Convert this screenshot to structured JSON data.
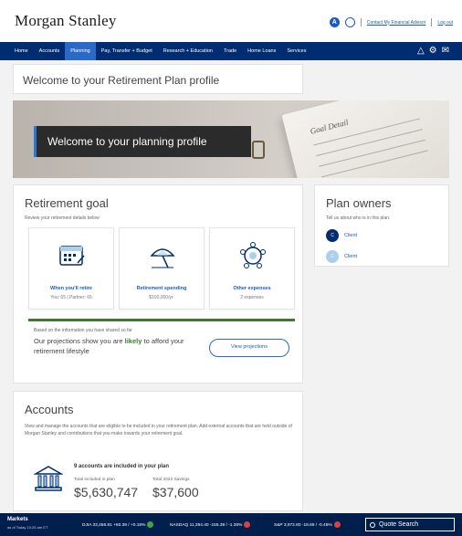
{
  "brand": {
    "logo": "Morgan Stanley",
    "accent": "#002d72",
    "link": "#1a5bbf",
    "green": "#3c7a2f"
  },
  "header": {
    "avatar_initial": "A",
    "contact_link": "Contact My Financial Advisor",
    "logout_link": "Log out"
  },
  "nav": {
    "items": [
      "Home",
      "Accounts",
      "Planning",
      "Pay, Transfer + Budget",
      "Research + Education",
      "Trade",
      "Home Loans",
      "Services"
    ],
    "active": "Planning",
    "icons": [
      "bell-icon",
      "gear-icon",
      "mail-icon"
    ]
  },
  "page": {
    "title": "Welcome to your Retirement Plan profile"
  },
  "banner": {
    "label": "Welcome to your planning profile",
    "paper_text": "Goal Detail"
  },
  "retirement_goal": {
    "title": "Retirement goal",
    "subtitle": "Review your retirement details below",
    "tiles": [
      {
        "icon": "calendar-icon",
        "title": "When you'll retire",
        "value": "You: 65 | Partner: 65"
      },
      {
        "icon": "umbrella-icon",
        "title": "Retirement spending",
        "value": "$100,000/yr."
      },
      {
        "icon": "expenses-icon",
        "title": "Other expenses",
        "value": "2 expenses"
      }
    ],
    "projection": {
      "small": "Based on the information you have shared so far",
      "text_before": "Our projections show you are ",
      "highlight": "likely",
      "text_after": " to afford your retirement lifestyle",
      "button": "View projections"
    }
  },
  "plan_owners": {
    "title": "Plan owners",
    "subtitle": "Tell us about who is in this plan.",
    "owners": [
      {
        "initial": "C",
        "name": "Client"
      },
      {
        "initial": "C",
        "name": "Client"
      }
    ]
  },
  "accounts": {
    "title": "Accounts",
    "description": "View and manage the accounts that are eligible to be included in your retirement plan. Add external accounts that are held outside of Morgan Stanley and contributions that you make towards your retirement goal.",
    "count_text": "9 accounts are included in your plan",
    "total_label": "Total included in plan",
    "total_value": "$5,630,747",
    "savings_label": "Total 2022 Savings",
    "savings_value": "$37,600"
  },
  "ticker": {
    "title": "Markets",
    "as_of": "as of Today 10:25 am ET",
    "items": [
      {
        "text": "DJIA 33,456.81  +60.39 / +0.18%",
        "dir": "up"
      },
      {
        "text": "NASDAQ 11,394.40  -155.39 / -1.36%",
        "dir": "down"
      },
      {
        "text": "S&P 3,972.80  -18.69 / -0.48%",
        "dir": "down"
      }
    ],
    "search_placeholder": "Quote Search"
  }
}
